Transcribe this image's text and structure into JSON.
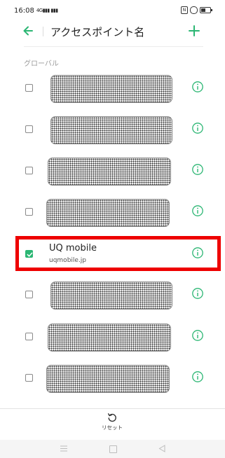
{
  "status_bar": {
    "time": "16:08",
    "signal_icons": "4G▮▮▮ ▮▮▮"
  },
  "header": {
    "title": "アクセスポイント名",
    "back_icon": "arrow-left-icon",
    "add_icon": "plus-icon"
  },
  "section_label": "グローバル",
  "apn_list": [
    {
      "checked": false,
      "name": null,
      "subtitle": null,
      "redacted": true
    },
    {
      "checked": false,
      "name": null,
      "subtitle": null,
      "redacted": true
    },
    {
      "checked": false,
      "name": null,
      "subtitle": null,
      "redacted": true
    },
    {
      "checked": false,
      "name": null,
      "subtitle": null,
      "redacted": true
    },
    {
      "checked": true,
      "name": "UQ mobile",
      "subtitle": "uqmobile.jp",
      "redacted": false
    },
    {
      "checked": false,
      "name": null,
      "subtitle": null,
      "redacted": true
    },
    {
      "checked": false,
      "name": null,
      "subtitle": null,
      "redacted": true
    },
    {
      "checked": false,
      "name": null,
      "subtitle": null,
      "redacted": true
    }
  ],
  "reset": {
    "label": "リセット",
    "icon": "reset-icon"
  },
  "colors": {
    "accent": "#2bb673",
    "highlight": "#ee0000"
  }
}
